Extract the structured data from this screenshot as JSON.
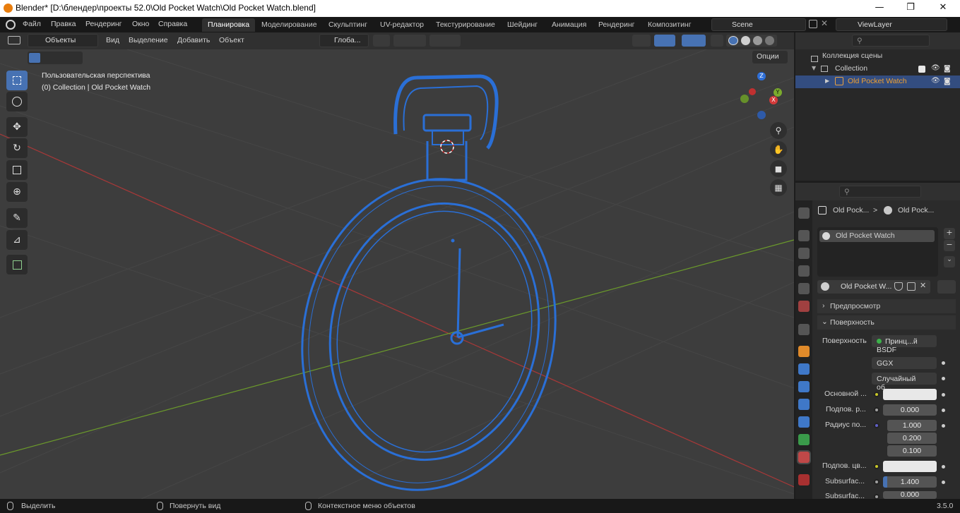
{
  "window": {
    "title": "Blender* [D:\\блендер\\проекты 52.0\\Old Pocket Watch\\Old Pocket Watch.blend]",
    "controls": [
      "—",
      "❐",
      "✕"
    ]
  },
  "menu": [
    "Файл",
    "Правка",
    "Рендеринг",
    "Окно",
    "Справка"
  ],
  "workspaces": [
    "Планировка",
    "Моделирование",
    "Скульптинг",
    "UV-редактор",
    "Текстурирование",
    "Шейдинг",
    "Анимация",
    "Рендеринг",
    "Композитинг"
  ],
  "active_workspace": "Планировка",
  "scene": "Scene",
  "view_layer": "ViewLayer",
  "viewport_header": {
    "mode": "Объекты",
    "menus": [
      "Вид",
      "Выделение",
      "Добавить",
      "Объект"
    ],
    "transform_orientation": "Глоба...",
    "options_label": "Опции"
  },
  "viewport": {
    "perspective_label": "Пользовательская перспектива",
    "collection_label": "(0) Collection | Old Pocket Watch",
    "gizmo_axes": [
      "Z",
      "Y",
      "X"
    ]
  },
  "outliner": {
    "scene_collection": "Коллекция сцены",
    "collection": "Collection",
    "object": "Old Pocket Watch"
  },
  "properties": {
    "breadcrumb_1": "Old Pock...",
    "breadcrumb_2": "Old Pock...",
    "material_slot": "Old Pocket Watch",
    "material_name": "Old Pocket W...",
    "panels": {
      "preview": "Предпросмотр",
      "surface": "Поверхность"
    },
    "surface_label": "Поверхность",
    "surface_value": "Принц...й BSDF",
    "distribution": "GGX",
    "subsurface_method": "Случайный об...",
    "rows": [
      {
        "label": "Основной ...",
        "value": ""
      },
      {
        "label": "Подпов. р...",
        "value": "0.000"
      },
      {
        "label": "Радиус по...",
        "value": "1.000"
      },
      {
        "label": "",
        "value": "0.200"
      },
      {
        "label": "",
        "value": "0.100"
      },
      {
        "label": "Подпов. цв...",
        "value": ""
      },
      {
        "label": "Subsurfac...",
        "value": "1.400"
      },
      {
        "label": "Subsurfac...",
        "value": "0.000"
      }
    ]
  },
  "status": {
    "left": "Выделить",
    "middle": "Повернуть вид",
    "right": "Контекстное меню объектов",
    "version": "3.5.0"
  },
  "colors": {
    "accent": "#4772b3",
    "wire": "#2a6fd6",
    "x_axis": "#b03434",
    "y_axis": "#6a9a2a",
    "orange": "#e87d0d"
  }
}
